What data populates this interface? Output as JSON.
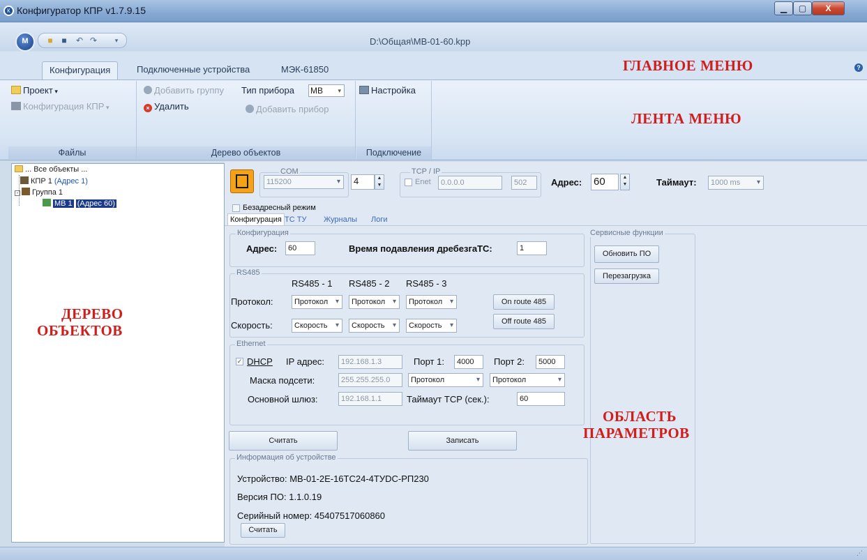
{
  "window": {
    "title": "Конфигуратор КПР v1.7.9.15",
    "file_path": "D:\\Общая\\МВ-01-60.kpp",
    "app_icon": "КПР-logo-icon"
  },
  "tabs": [
    "Конфигурация",
    "Подключенные устройства",
    "МЭК-61850"
  ],
  "ribbon": {
    "files": {
      "project": "Проект",
      "config_kpr": "Конфигурация КПР",
      "label": "Файлы"
    },
    "tree": {
      "add_group": "Добавить группу",
      "device_type_label": "Тип прибора",
      "device_type": "МВ",
      "delete": "Удалить",
      "add_device": "Добавить прибор",
      "label": "Дерево объектов"
    },
    "connection": {
      "settings": "Настройка",
      "label": "Подключение"
    }
  },
  "tree": {
    "root": "... Все объекты ...",
    "kpr": "КПР 1",
    "kpr_addr": "(Адрес 1)",
    "group": "Группа 1",
    "device": "МВ 1",
    "device_addr": "(Адрес 60)"
  },
  "connection": {
    "com_label": "COM",
    "com_speed": "115200",
    "com_port": "4",
    "tcp_label": "TCP / IP",
    "enet": "Enet",
    "ip": "0.0.0.0",
    "port": "502",
    "address_label": "Адрес:",
    "address": "60",
    "timeout_label": "Таймаут:",
    "timeout": "1000 ms",
    "addressless": "Безадресный режим"
  },
  "subtabs": [
    "Конфигурация",
    "ТС ТУ",
    "Журналы",
    "Логи"
  ],
  "config": {
    "title": "Конфигурация",
    "addr_label": "Адрес:",
    "addr": "60",
    "debounce_label": "Время подавления дребезгаТС:",
    "debounce": "1"
  },
  "rs485": {
    "title": "RS485",
    "headers": [
      "RS485 - 1",
      "RS485 - 2",
      "RS485 - 3"
    ],
    "protocol_label": "Протокол:",
    "protocol": "Протокол",
    "speed_label": "Скорость:",
    "speed": "Скорость",
    "on_route": "On route 485",
    "off_route": "Off route 485"
  },
  "ethernet": {
    "title": "Ethernet",
    "dhcp": "DHCP",
    "ip_label": "IP адрес:",
    "ip": "192.168.1.3",
    "port1_label": "Порт 1:",
    "port1": "4000",
    "port2_label": "Порт 2:",
    "port2": "5000",
    "mask_label": "Маска подсети:",
    "mask": "255.255.255.0",
    "proto1": "Протокол",
    "proto2": "Протокол",
    "gateway_label": "Основной шлюз:",
    "gateway": "192.168.1.1",
    "tcp_timeout_label": "Таймаут TCP (сек.):",
    "tcp_timeout": "60"
  },
  "actions": {
    "read": "Считать",
    "write": "Записать"
  },
  "service": {
    "title": "Сервисные функции",
    "update": "Обновить ПО",
    "reboot": "Перезагрузка"
  },
  "device_info": {
    "title": "Информация об устройстве",
    "device": "Устройство:  МВ-01-2Е-16ТС24-4ТУDC-РП230",
    "version": "Версия ПО:  1.1.0.19",
    "serial": "Серийный номер:  45407517060860",
    "read": "Считать"
  },
  "annotations": {
    "main_menu": "ГЛАВНОЕ  МЕНЮ",
    "ribbon": "ЛЕНТА  МЕНЮ",
    "tree1": "ДЕРЕВО",
    "tree2": "ОБЪЕКТОВ",
    "params1": "ОБЛАСТЬ",
    "params2": "ПАРАМЕТРОВ"
  }
}
